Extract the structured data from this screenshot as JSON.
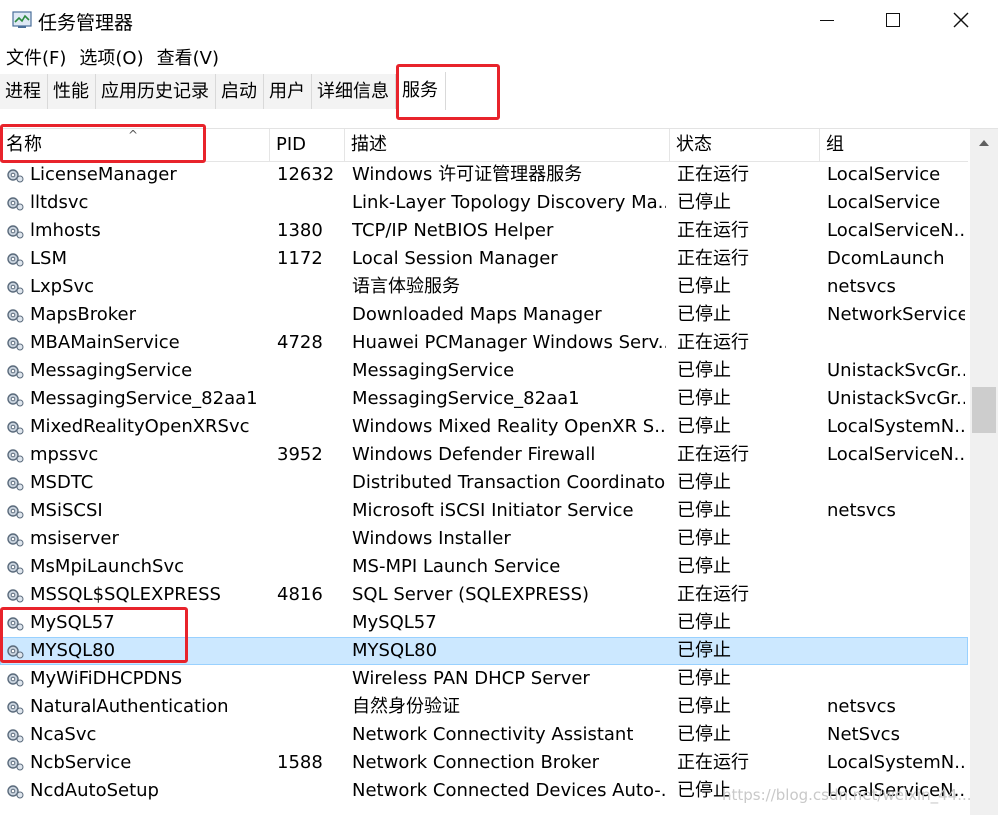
{
  "window": {
    "title": "任务管理器"
  },
  "menu": [
    "文件(F)",
    "选项(O)",
    "查看(V)"
  ],
  "tabs": [
    "进程",
    "性能",
    "应用历史记录",
    "启动",
    "用户",
    "详细信息",
    "服务"
  ],
  "active_tab": "服务",
  "columns": {
    "name": "名称",
    "pid": "PID",
    "desc": "描述",
    "status": "状态",
    "group": "组"
  },
  "sort_indicator": "^",
  "selected_service": "MYSQL80",
  "rows": [
    {
      "name": "LicenseManager",
      "pid": "12632",
      "desc": "Windows 许可证管理器服务",
      "status": "正在运行",
      "group": "LocalService"
    },
    {
      "name": "lltdsvc",
      "pid": "",
      "desc": "Link-Layer Topology Discovery Ma...",
      "status": "已停止",
      "group": "LocalService"
    },
    {
      "name": "lmhosts",
      "pid": "1380",
      "desc": "TCP/IP NetBIOS Helper",
      "status": "正在运行",
      "group": "LocalServiceN..."
    },
    {
      "name": "LSM",
      "pid": "1172",
      "desc": "Local Session Manager",
      "status": "正在运行",
      "group": "DcomLaunch"
    },
    {
      "name": "LxpSvc",
      "pid": "",
      "desc": "语言体验服务",
      "status": "已停止",
      "group": "netsvcs"
    },
    {
      "name": "MapsBroker",
      "pid": "",
      "desc": "Downloaded Maps Manager",
      "status": "已停止",
      "group": "NetworkService"
    },
    {
      "name": "MBAMainService",
      "pid": "4728",
      "desc": "Huawei PCManager Windows Serv...",
      "status": "正在运行",
      "group": ""
    },
    {
      "name": "MessagingService",
      "pid": "",
      "desc": "MessagingService",
      "status": "已停止",
      "group": "UnistackSvcGr..."
    },
    {
      "name": "MessagingService_82aa1",
      "pid": "",
      "desc": "MessagingService_82aa1",
      "status": "已停止",
      "group": "UnistackSvcGr..."
    },
    {
      "name": "MixedRealityOpenXRSvc",
      "pid": "",
      "desc": "Windows Mixed Reality OpenXR S...",
      "status": "已停止",
      "group": "LocalSystemN..."
    },
    {
      "name": "mpssvc",
      "pid": "3952",
      "desc": "Windows Defender Firewall",
      "status": "正在运行",
      "group": "LocalServiceN..."
    },
    {
      "name": "MSDTC",
      "pid": "",
      "desc": "Distributed Transaction Coordinator",
      "status": "已停止",
      "group": ""
    },
    {
      "name": "MSiSCSI",
      "pid": "",
      "desc": "Microsoft iSCSI Initiator Service",
      "status": "已停止",
      "group": "netsvcs"
    },
    {
      "name": "msiserver",
      "pid": "",
      "desc": "Windows Installer",
      "status": "已停止",
      "group": ""
    },
    {
      "name": "MsMpiLaunchSvc",
      "pid": "",
      "desc": "MS-MPI Launch Service",
      "status": "已停止",
      "group": ""
    },
    {
      "name": "MSSQL$SQLEXPRESS",
      "pid": "4816",
      "desc": "SQL Server (SQLEXPRESS)",
      "status": "正在运行",
      "group": ""
    },
    {
      "name": "MySQL57",
      "pid": "",
      "desc": "MySQL57",
      "status": "已停止",
      "group": ""
    },
    {
      "name": "MYSQL80",
      "pid": "",
      "desc": "MYSQL80",
      "status": "已停止",
      "group": ""
    },
    {
      "name": "MyWiFiDHCPDNS",
      "pid": "",
      "desc": "Wireless PAN DHCP Server",
      "status": "已停止",
      "group": ""
    },
    {
      "name": "NaturalAuthentication",
      "pid": "",
      "desc": "自然身份验证",
      "status": "已停止",
      "group": "netsvcs"
    },
    {
      "name": "NcaSvc",
      "pid": "",
      "desc": "Network Connectivity Assistant",
      "status": "已停止",
      "group": "NetSvcs"
    },
    {
      "name": "NcbService",
      "pid": "1588",
      "desc": "Network Connection Broker",
      "status": "正在运行",
      "group": "LocalSystemN..."
    },
    {
      "name": "NcdAutoSetup",
      "pid": "",
      "desc": "Network Connected Devices Auto-...",
      "status": "已停止",
      "group": "LocalServiceN..."
    }
  ],
  "watermark": "https://blog.csdn.net/weixin_44..."
}
